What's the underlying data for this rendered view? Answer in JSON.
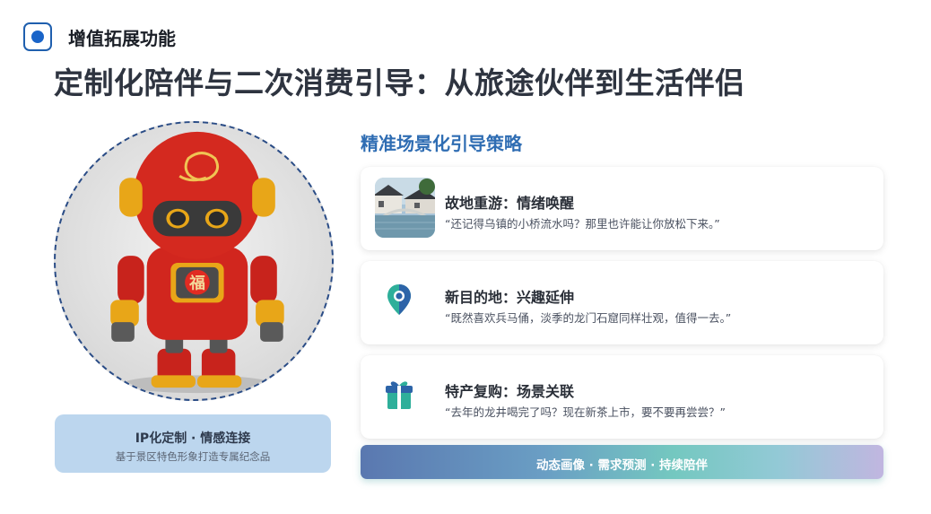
{
  "header": {
    "section_label": "增值拓展功能",
    "title": "定制化陪伴与二次消费引导：从旅途伙伴到生活伴侣"
  },
  "left": {
    "image_alt": "red robot mascot with 福 character",
    "robot_chest_text": "福",
    "ip_card": {
      "title": "IP化定制 · 情感连接",
      "subtitle": "基于景区特色形象打造专属纪念品"
    }
  },
  "strategy": {
    "heading": "精准场景化引导策略",
    "cards": [
      {
        "icon": "water-town-photo",
        "title": "故地重游：情绪唤醒",
        "quote": "“还记得乌镇的小桥流水吗？那里也许能让你放松下来。”"
      },
      {
        "icon": "map-pin-icon",
        "title": "新目的地：兴趣延伸",
        "quote": "“既然喜欢兵马俑，淡季的龙门石窟同样壮观，值得一去。”"
      },
      {
        "icon": "gift-box-icon",
        "title": "特产复购：场景关联",
        "quote": "“去年的龙井喝完了吗？现在新茶上市，要不要再尝尝？”"
      }
    ],
    "banner": "动态画像 · 需求预测 · 持续陪伴"
  },
  "colors": {
    "accent": "#2f6db3",
    "title": "#2e3440",
    "ip_card_bg": "#bcd6ee",
    "pin_teal": "#2eaf9a",
    "pin_blue": "#2d64a8"
  }
}
